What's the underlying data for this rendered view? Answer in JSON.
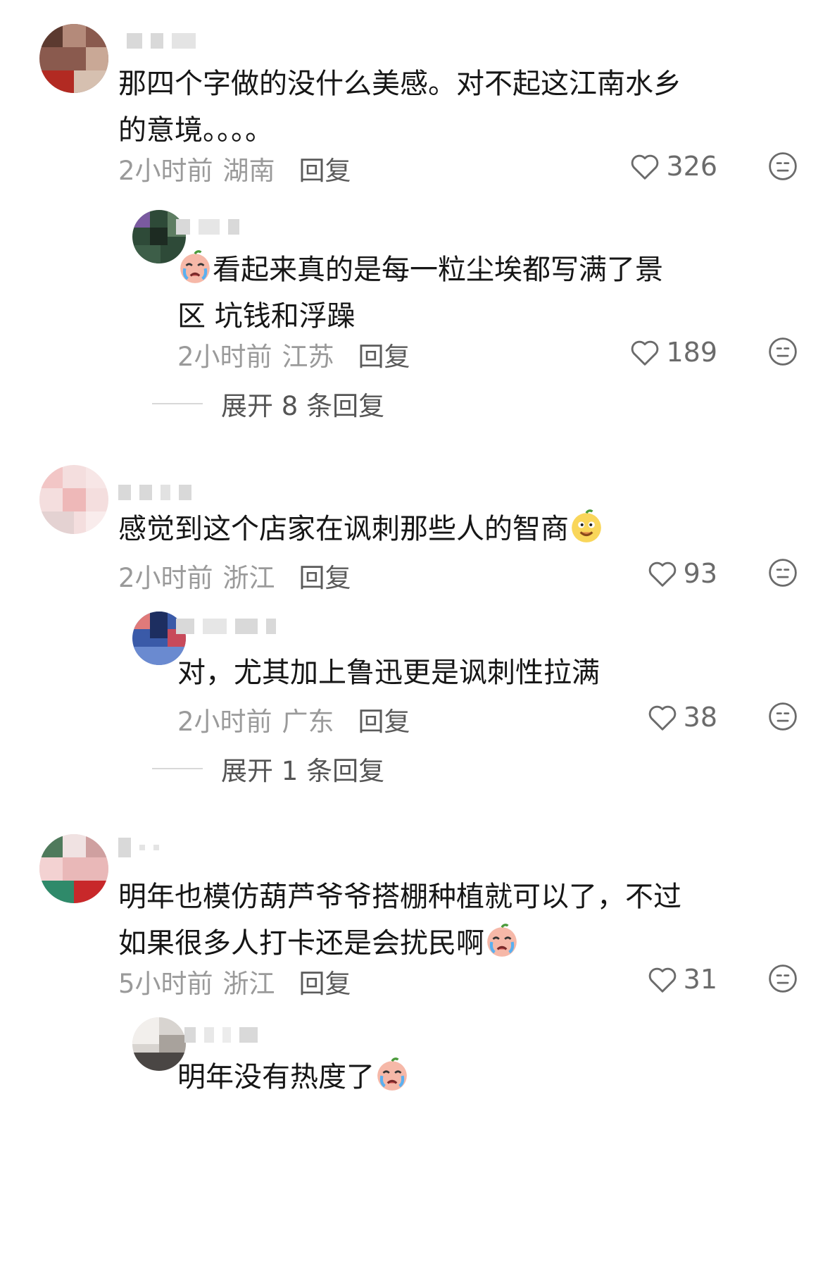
{
  "comments": [
    {
      "text": "那四个字做的没什么美感。对不起这江南水乡的意境。。。。",
      "time": "2小时前",
      "location": "湖南",
      "reply": "回复",
      "likes": "326",
      "replies": [
        {
          "text": "看起来真的是每一粒尘埃都写满了景区 坑钱和浮躁",
          "time": "2小时前",
          "location": "江苏",
          "reply": "回复",
          "likes": "189"
        }
      ],
      "expand": "展开 8 条回复"
    },
    {
      "text": "感觉到这个店家在讽刺那些人的智商",
      "time": "2小时前",
      "location": "浙江",
      "reply": "回复",
      "likes": "93",
      "replies": [
        {
          "text": "对，尤其加上鲁迅更是讽刺性拉满",
          "time": "2小时前",
          "location": "广东",
          "reply": "回复",
          "likes": "38"
        }
      ],
      "expand": "展开 1 条回复"
    },
    {
      "text": "明年也模仿葫芦爷爷搭棚种植就可以了，不过如果很多人打卡还是会扰民啊",
      "time": "5小时前",
      "location": "浙江",
      "reply": "回复",
      "likes": "31",
      "replies": [
        {
          "text": "明年没有热度了",
          "time": "",
          "location": "",
          "reply": "",
          "likes": ""
        }
      ]
    }
  ],
  "icons": {
    "like": "heart-outline-icon",
    "dislike": "neutral-face-icon",
    "crying": "crying-emoji",
    "smirk": "smirk-emoji"
  }
}
